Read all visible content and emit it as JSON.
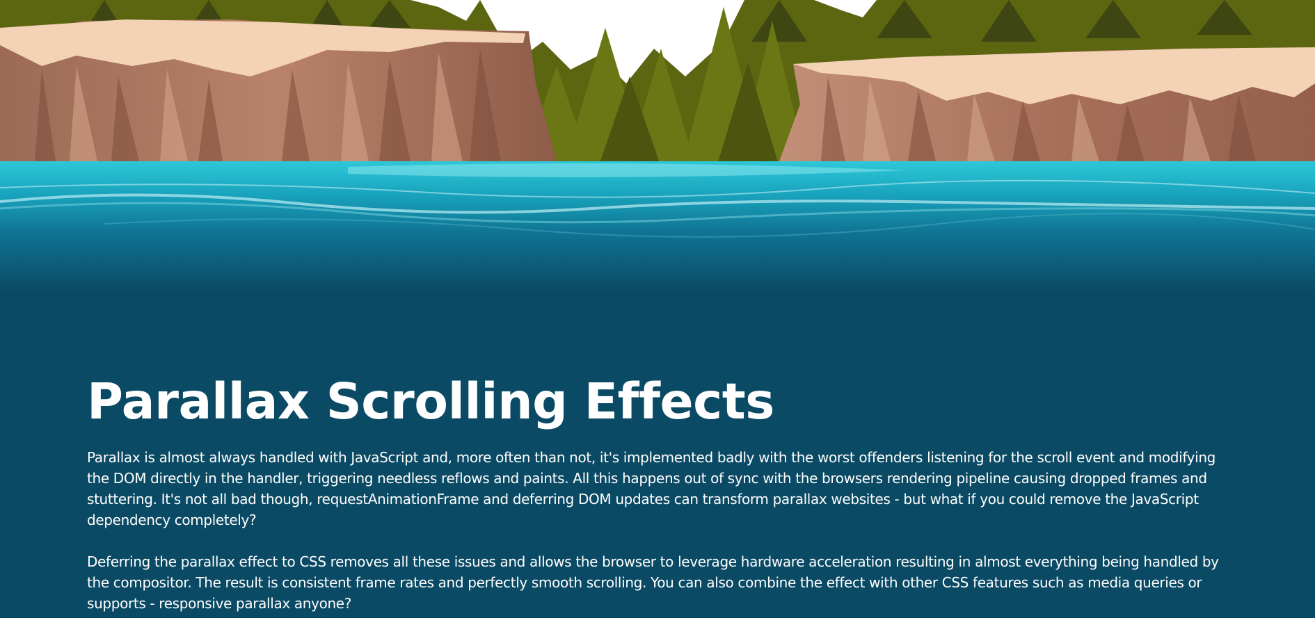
{
  "theme": {
    "page_background": "#0b4a64",
    "text_color": "#ffffff",
    "sky": "#ffffff",
    "forest": "#5f6a10",
    "cliff": "#b07a63",
    "cliff_top": "#f2cfb0",
    "water": "#1aa5bd"
  },
  "hero": {
    "scene": "forest-cliffs-lake-illustration"
  },
  "article": {
    "title": "Parallax Scrolling Effects",
    "paragraphs": [
      "Parallax is almost always handled with JavaScript and, more often than not, it's implemented badly with the worst offenders listening for the scroll event and modifying the DOM directly in the handler, triggering needless reflows and paints. All this happens out of sync with the browsers rendering pipeline causing dropped frames and stuttering. It's not all bad though, requestAnimationFrame and deferring DOM updates can transform parallax websites - but what if you could remove the JavaScript dependency completely?",
      "Deferring the parallax effect to CSS removes all these issues and allows the browser to leverage hardware acceleration resulting in almost everything being handled by the compositor. The result is consistent frame rates and perfectly smooth scrolling. You can also combine the effect with other CSS features such as media queries or supports - responsive parallax anyone?"
    ]
  }
}
